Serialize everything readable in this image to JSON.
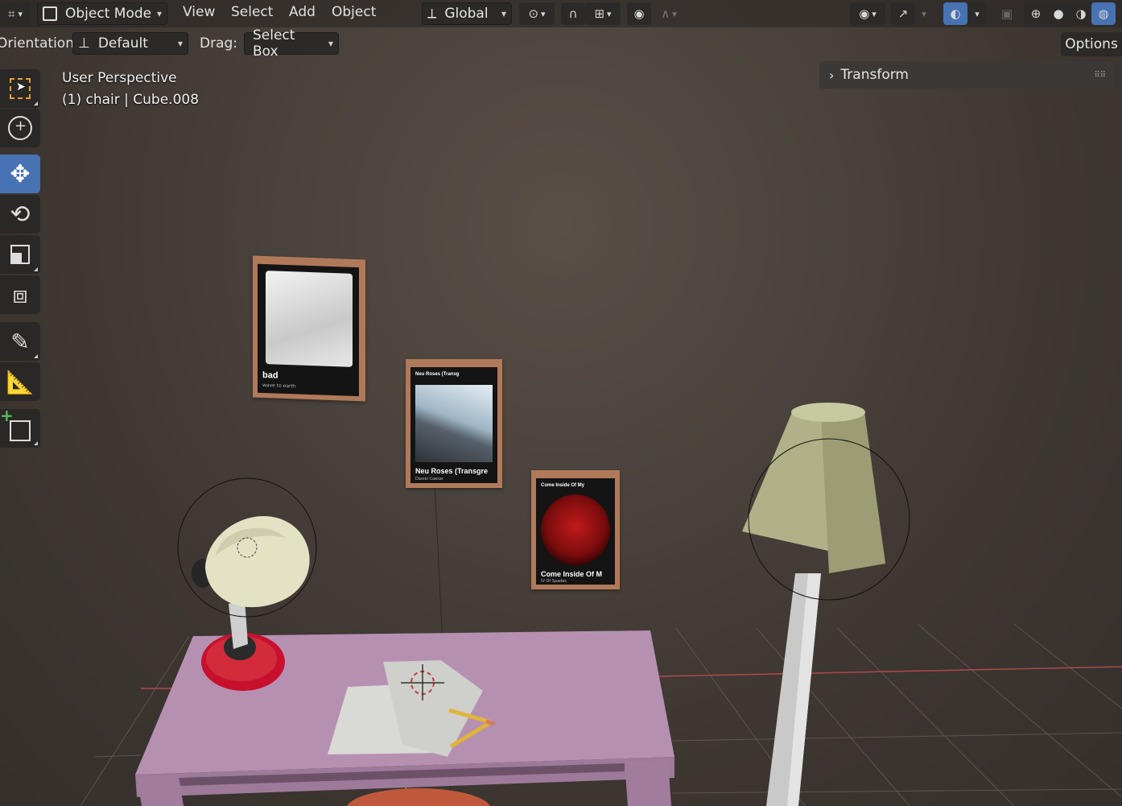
{
  "header": {
    "mode_label": "Object Mode",
    "menus": [
      "View",
      "Select",
      "Add",
      "Object"
    ],
    "transform_orientation": "Global"
  },
  "subheader": {
    "orientation_label": "Orientation:",
    "orientation_value": "Default",
    "drag_label": "Drag:",
    "drag_value": "Select Box",
    "options_label": "Options"
  },
  "viewport": {
    "view_name": "User Perspective",
    "active_object": "(1) chair | Cube.008"
  },
  "sidebar": {
    "transform_panel_label": "Transform"
  },
  "toolbar": {
    "tools": [
      "select-box",
      "cursor",
      "move",
      "rotate",
      "scale",
      "transform",
      "annotate",
      "measure",
      "add-cube"
    ],
    "active_tool": "move"
  },
  "posters": {
    "poster1": {
      "title": "bad",
      "subtitle": "wave to earth"
    },
    "poster2": {
      "header": "Neu Roses (Transg",
      "title": "Neu Roses (Transgre",
      "subtitle": "Daniel Caesar"
    },
    "poster3": {
      "header": "Come Inside Of My",
      "title": "Come Inside Of M",
      "subtitle": "IV Of Spades"
    }
  },
  "colors": {
    "accent": "#4772b3",
    "toolbar_bg": "#2a2827",
    "viewport_bg": "#3f3833"
  }
}
